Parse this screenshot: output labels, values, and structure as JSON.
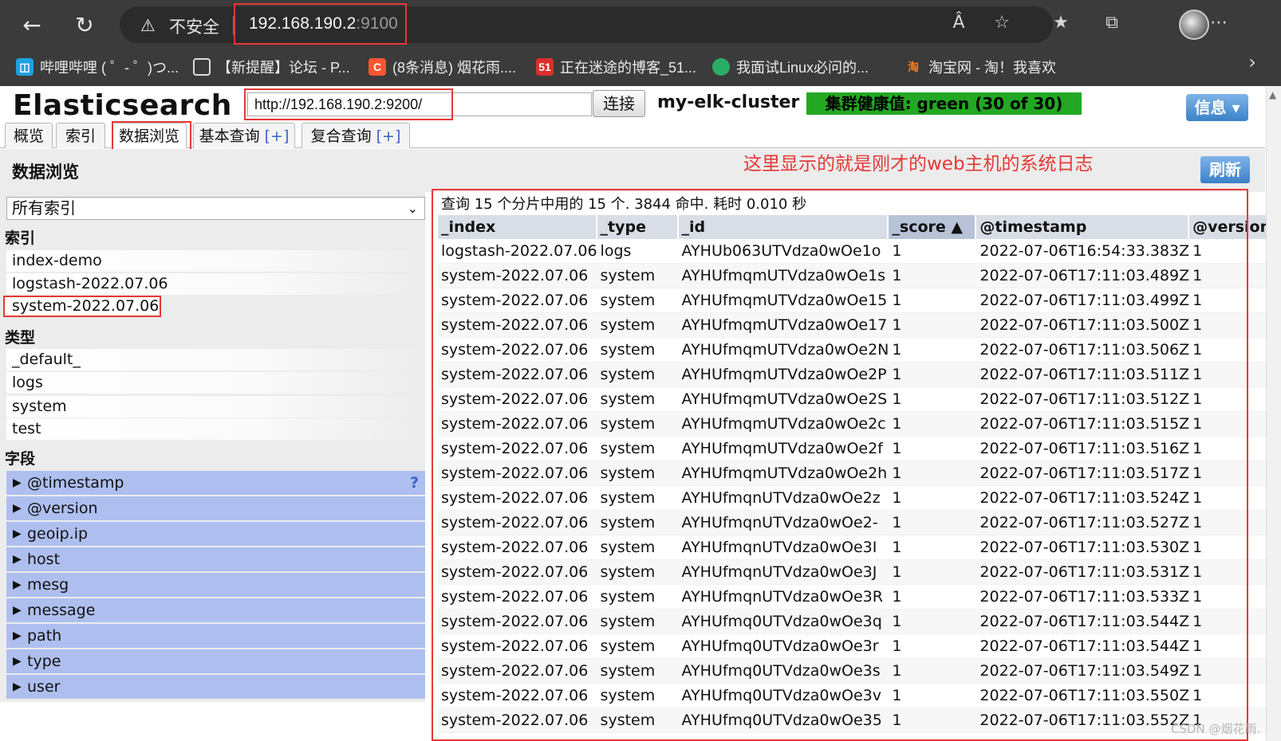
{
  "browser": {
    "security_label": "不安全",
    "url_host": "192.168.190.2",
    "url_port": ":9100",
    "bookmarks": [
      "哔哩哔哩 ( ゜- ゜)つ...",
      "【新提醒】论坛 - P...",
      "(8条消息) 烟花雨....",
      "正在迷途的博客_51...",
      "我面试Linux必问的...",
      "淘宝网 - 淘！我喜欢"
    ]
  },
  "header": {
    "app_title": "Elasticsearch",
    "connect_url": "http://192.168.190.2:9200/",
    "connect_button": "连接",
    "cluster_name": "my-elk-cluster",
    "health": "集群健康值: green (30 of 30)",
    "info_button": "信息 ▾"
  },
  "tabs": [
    {
      "label": "概览",
      "plus": ""
    },
    {
      "label": "索引",
      "plus": ""
    },
    {
      "label": "数据浏览",
      "plus": ""
    },
    {
      "label": "基本查询 ",
      "plus": "[+]"
    },
    {
      "label": "复合查询 ",
      "plus": "[+]"
    }
  ],
  "panel": {
    "title": "数据浏览",
    "annotation": "这里显示的就是刚才的web主机的系统日志",
    "refresh_button": "刷新"
  },
  "sidebar": {
    "index_select": "所有索引",
    "indices_heading": "索引",
    "indices": [
      "index-demo",
      "logstash-2022.07.06",
      "system-2022.07.06"
    ],
    "types_heading": "类型",
    "types": [
      "_default_",
      "logs",
      "system",
      "test"
    ],
    "fields_heading": "字段",
    "fields": [
      "@timestamp",
      "@version",
      "geoip.ip",
      "host",
      "mesg",
      "message",
      "path",
      "type",
      "user"
    ],
    "help_icon": "?"
  },
  "results": {
    "summary": "查询 15 个分片中用的 15 个. 3844 命中. 耗时 0.010 秒",
    "columns": [
      "_index",
      "_type",
      "_id",
      "_score ▲",
      "@timestamp",
      "@version"
    ],
    "rows": [
      [
        "logstash-2022.07.06",
        "logs",
        "AYHUb063UTVdza0wOe1o",
        "1",
        "2022-07-06T16:54:33.383Z",
        "1"
      ],
      [
        "system-2022.07.06",
        "system",
        "AYHUfmqmUTVdza0wOe1s",
        "1",
        "2022-07-06T17:11:03.489Z",
        "1"
      ],
      [
        "system-2022.07.06",
        "system",
        "AYHUfmqmUTVdza0wOe15",
        "1",
        "2022-07-06T17:11:03.499Z",
        "1"
      ],
      [
        "system-2022.07.06",
        "system",
        "AYHUfmqmUTVdza0wOe17",
        "1",
        "2022-07-06T17:11:03.500Z",
        "1"
      ],
      [
        "system-2022.07.06",
        "system",
        "AYHUfmqmUTVdza0wOe2N",
        "1",
        "2022-07-06T17:11:03.506Z",
        "1"
      ],
      [
        "system-2022.07.06",
        "system",
        "AYHUfmqmUTVdza0wOe2P",
        "1",
        "2022-07-06T17:11:03.511Z",
        "1"
      ],
      [
        "system-2022.07.06",
        "system",
        "AYHUfmqmUTVdza0wOe2S",
        "1",
        "2022-07-06T17:11:03.512Z",
        "1"
      ],
      [
        "system-2022.07.06",
        "system",
        "AYHUfmqmUTVdza0wOe2c",
        "1",
        "2022-07-06T17:11:03.515Z",
        "1"
      ],
      [
        "system-2022.07.06",
        "system",
        "AYHUfmqmUTVdza0wOe2f",
        "1",
        "2022-07-06T17:11:03.516Z",
        "1"
      ],
      [
        "system-2022.07.06",
        "system",
        "AYHUfmqmUTVdza0wOe2h",
        "1",
        "2022-07-06T17:11:03.517Z",
        "1"
      ],
      [
        "system-2022.07.06",
        "system",
        "AYHUfmqnUTVdza0wOe2z",
        "1",
        "2022-07-06T17:11:03.524Z",
        "1"
      ],
      [
        "system-2022.07.06",
        "system",
        "AYHUfmqnUTVdza0wOe2-",
        "1",
        "2022-07-06T17:11:03.527Z",
        "1"
      ],
      [
        "system-2022.07.06",
        "system",
        "AYHUfmqnUTVdza0wOe3I",
        "1",
        "2022-07-06T17:11:03.530Z",
        "1"
      ],
      [
        "system-2022.07.06",
        "system",
        "AYHUfmqnUTVdza0wOe3J",
        "1",
        "2022-07-06T17:11:03.531Z",
        "1"
      ],
      [
        "system-2022.07.06",
        "system",
        "AYHUfmqnUTVdza0wOe3R",
        "1",
        "2022-07-06T17:11:03.533Z",
        "1"
      ],
      [
        "system-2022.07.06",
        "system",
        "AYHUfmq0UTVdza0wOe3q",
        "1",
        "2022-07-06T17:11:03.544Z",
        "1"
      ],
      [
        "system-2022.07.06",
        "system",
        "AYHUfmq0UTVdza0wOe3r",
        "1",
        "2022-07-06T17:11:03.544Z",
        "1"
      ],
      [
        "system-2022.07.06",
        "system",
        "AYHUfmq0UTVdza0wOe3s",
        "1",
        "2022-07-06T17:11:03.549Z",
        "1"
      ],
      [
        "system-2022.07.06",
        "system",
        "AYHUfmq0UTVdza0wOe3v",
        "1",
        "2022-07-06T17:11:03.550Z",
        "1"
      ],
      [
        "system-2022.07.06",
        "system",
        "AYHUfmq0UTVdza0wOe35",
        "1",
        "2022-07-06T17:11:03.552Z",
        "1"
      ]
    ]
  },
  "watermark": "CSDN @烟花雨."
}
